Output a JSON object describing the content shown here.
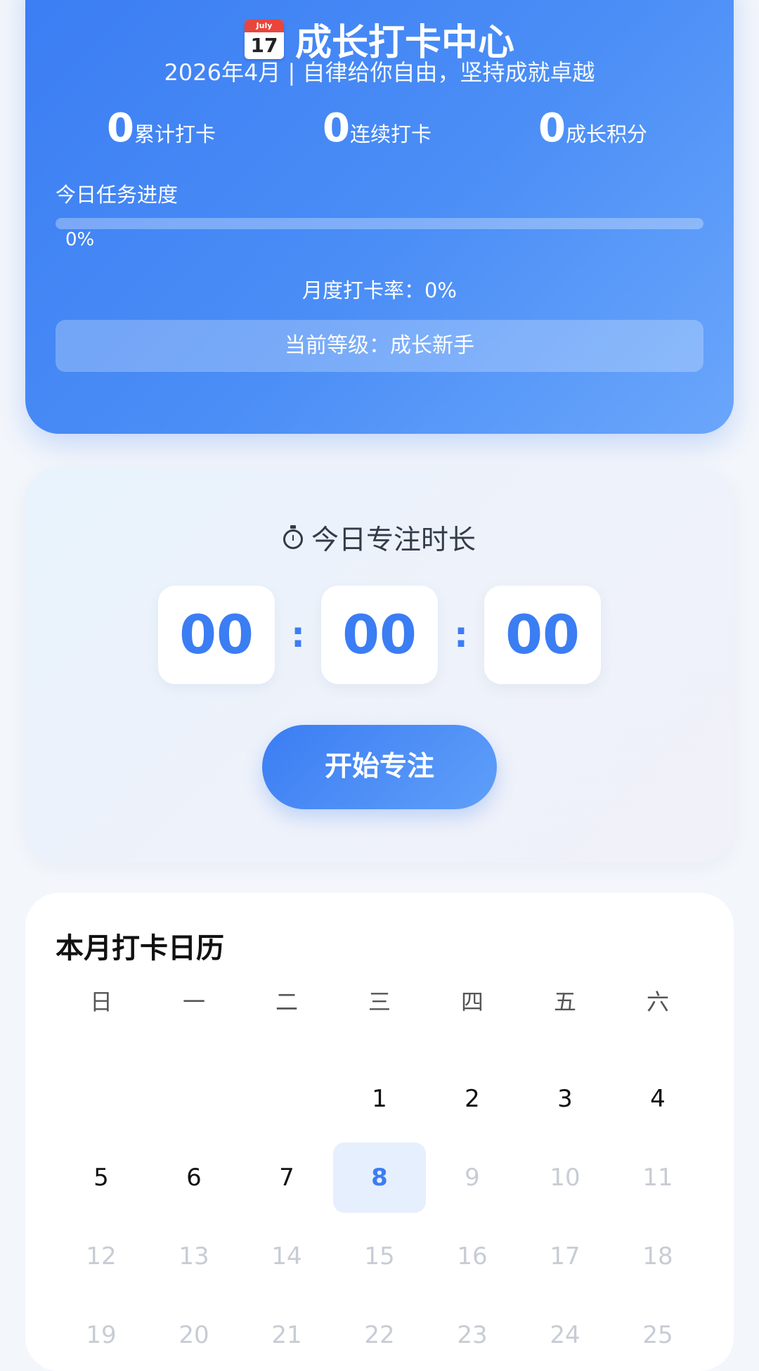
{
  "hero": {
    "title": "成长打卡中心",
    "calendar_icon": {
      "month": "July",
      "day": "17"
    },
    "subtitle": "2026年4月 | 自律给你自由，坚持成就卓越",
    "stats": [
      {
        "value": "0",
        "label": "累计打卡"
      },
      {
        "value": "0",
        "label": "连续打卡"
      },
      {
        "value": "0",
        "label": "成长积分"
      }
    ],
    "progress_label": "今日任务进度",
    "progress_fraction": 0,
    "progress_text": "0%",
    "monthly_rate": "月度打卡率：0%",
    "level": "当前等级：成长新手"
  },
  "focus": {
    "title": "今日专注时长",
    "icon": "stopwatch-icon",
    "hours": "00",
    "minutes": "00",
    "seconds": "00",
    "separator": ":",
    "start_button": "开始专注"
  },
  "calendar": {
    "title": "本月打卡日历",
    "weekdays": [
      "日",
      "一",
      "二",
      "三",
      "四",
      "五",
      "六"
    ],
    "weeks": [
      [
        "",
        "",
        "",
        "1",
        "2",
        "3",
        "4"
      ],
      [
        "5",
        "6",
        "7",
        "8",
        "9",
        "10",
        "11"
      ],
      [
        "12",
        "13",
        "14",
        "15",
        "16",
        "17",
        "18"
      ],
      [
        "19",
        "20",
        "21",
        "22",
        "23",
        "24",
        "25"
      ]
    ],
    "today": "8"
  },
  "colors": {
    "accent": "#3b7df3",
    "today_bg": "#e6effd",
    "future_text": "#c8ccd4"
  }
}
